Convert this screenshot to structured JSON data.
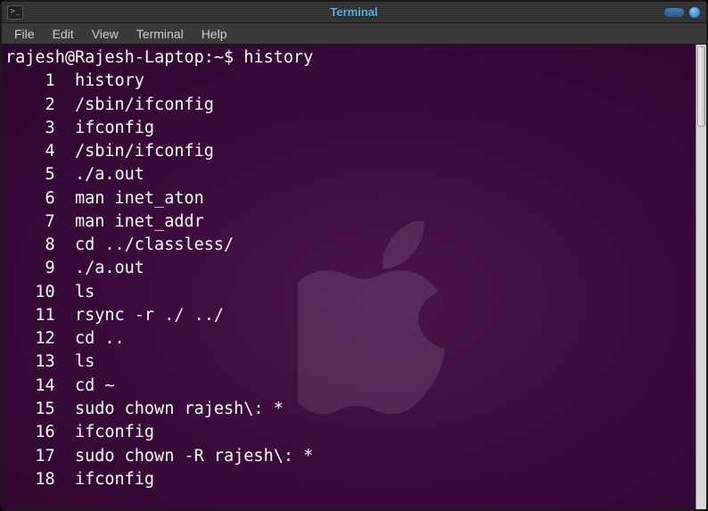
{
  "titlebar": {
    "title": "Terminal",
    "icon_glyph": ">_"
  },
  "menubar": {
    "items": [
      "File",
      "Edit",
      "View",
      "Terminal",
      "Help"
    ]
  },
  "prompt": {
    "user_host": "rajesh@Rajesh-Laptop",
    "path": "~",
    "symbol": "$",
    "command": "history"
  },
  "history": [
    {
      "n": "1",
      "cmd": "history"
    },
    {
      "n": "2",
      "cmd": "/sbin/ifconfig"
    },
    {
      "n": "3",
      "cmd": "ifconfig"
    },
    {
      "n": "4",
      "cmd": "/sbin/ifconfig"
    },
    {
      "n": "5",
      "cmd": "./a.out"
    },
    {
      "n": "6",
      "cmd": "man inet_aton"
    },
    {
      "n": "7",
      "cmd": "man inet_addr"
    },
    {
      "n": "8",
      "cmd": "cd ../classless/"
    },
    {
      "n": "9",
      "cmd": "./a.out"
    },
    {
      "n": "10",
      "cmd": "ls"
    },
    {
      "n": "11",
      "cmd": "rsync -r ./ ../"
    },
    {
      "n": "12",
      "cmd": "cd .."
    },
    {
      "n": "13",
      "cmd": "ls"
    },
    {
      "n": "14",
      "cmd": "cd ~"
    },
    {
      "n": "15",
      "cmd": "sudo chown rajesh\\: *"
    },
    {
      "n": "16",
      "cmd": "ifconfig"
    },
    {
      "n": "17",
      "cmd": "sudo chown -R rajesh\\: *"
    },
    {
      "n": "18",
      "cmd": "ifconfig"
    }
  ]
}
